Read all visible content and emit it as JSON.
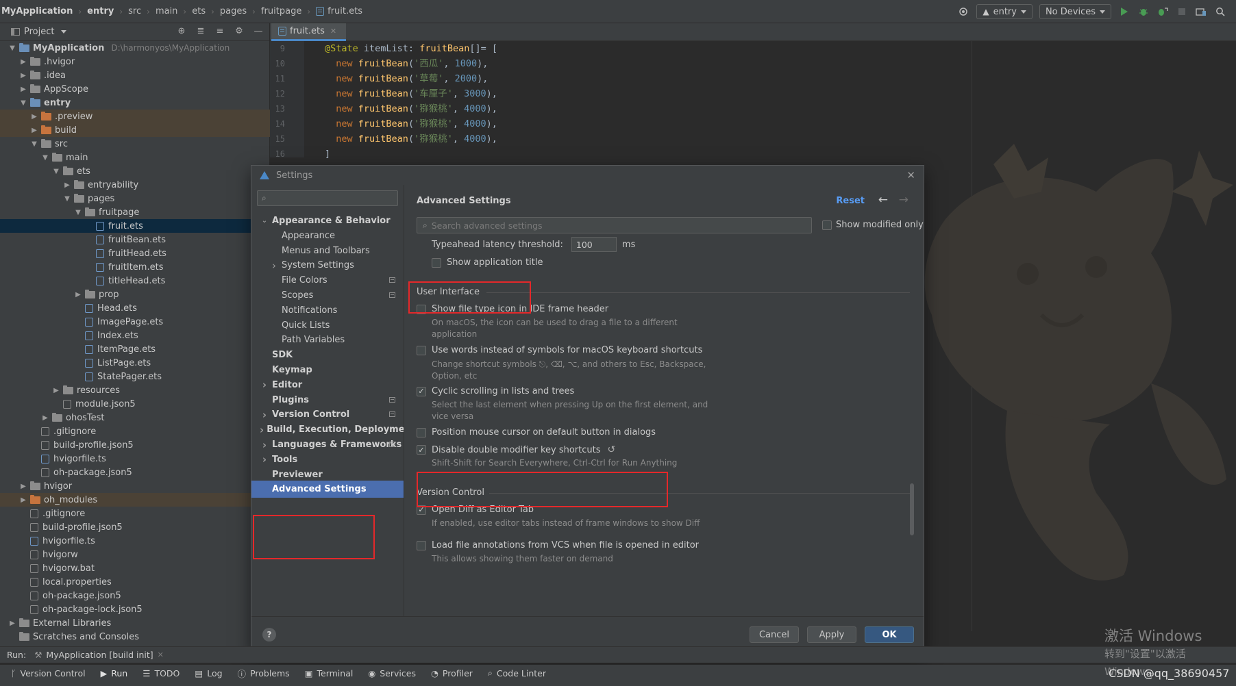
{
  "topbar": {
    "breadcrumbs": [
      "MyApplication",
      "entry",
      "src",
      "main",
      "ets",
      "pages",
      "fruitpage",
      "fruit.ets"
    ],
    "run_config": "entry",
    "device": "No Devices"
  },
  "project": {
    "panel_title": "Project",
    "tree": [
      {
        "label": "MyApplication",
        "path": "D:\\harmonyos\\MyApplication",
        "depth": 0,
        "expanded": true,
        "kind": "module"
      },
      {
        "label": ".hvigor",
        "depth": 1,
        "kind": "folder"
      },
      {
        "label": ".idea",
        "depth": 1,
        "kind": "folder"
      },
      {
        "label": "AppScope",
        "depth": 1,
        "kind": "folder"
      },
      {
        "label": "entry",
        "depth": 1,
        "expanded": true,
        "kind": "module"
      },
      {
        "label": ".preview",
        "depth": 2,
        "kind": "folder-orange",
        "hl": "brown"
      },
      {
        "label": "build",
        "depth": 2,
        "kind": "folder-orange",
        "hl": "brown"
      },
      {
        "label": "src",
        "depth": 2,
        "expanded": true,
        "kind": "folder"
      },
      {
        "label": "main",
        "depth": 3,
        "expanded": true,
        "kind": "folder"
      },
      {
        "label": "ets",
        "depth": 4,
        "expanded": true,
        "kind": "folder"
      },
      {
        "label": "entryability",
        "depth": 5,
        "kind": "folder"
      },
      {
        "label": "pages",
        "depth": 5,
        "expanded": true,
        "kind": "folder"
      },
      {
        "label": "fruitpage",
        "depth": 6,
        "expanded": true,
        "kind": "folder"
      },
      {
        "label": "fruit.ets",
        "depth": 7,
        "kind": "file",
        "hl": "sel"
      },
      {
        "label": "fruitBean.ets",
        "depth": 7,
        "kind": "file"
      },
      {
        "label": "fruitHead.ets",
        "depth": 7,
        "kind": "file"
      },
      {
        "label": "fruitItem.ets",
        "depth": 7,
        "kind": "file"
      },
      {
        "label": "titleHead.ets",
        "depth": 7,
        "kind": "file"
      },
      {
        "label": "prop",
        "depth": 6,
        "kind": "folder"
      },
      {
        "label": "Head.ets",
        "depth": 6,
        "kind": "file"
      },
      {
        "label": "ImagePage.ets",
        "depth": 6,
        "kind": "file"
      },
      {
        "label": "Index.ets",
        "depth": 6,
        "kind": "file"
      },
      {
        "label": "ItemPage.ets",
        "depth": 6,
        "kind": "file"
      },
      {
        "label": "ListPage.ets",
        "depth": 6,
        "kind": "file"
      },
      {
        "label": "StatePager.ets",
        "depth": 6,
        "kind": "file"
      },
      {
        "label": "resources",
        "depth": 4,
        "kind": "folder"
      },
      {
        "label": "module.json5",
        "depth": 4,
        "kind": "file-gray"
      },
      {
        "label": "ohosTest",
        "depth": 3,
        "kind": "folder"
      },
      {
        "label": ".gitignore",
        "depth": 2,
        "kind": "file-gray"
      },
      {
        "label": "build-profile.json5",
        "depth": 2,
        "kind": "file-gray"
      },
      {
        "label": "hvigorfile.ts",
        "depth": 2,
        "kind": "file"
      },
      {
        "label": "oh-package.json5",
        "depth": 2,
        "kind": "file-gray"
      },
      {
        "label": "hvigor",
        "depth": 1,
        "kind": "folder"
      },
      {
        "label": "oh_modules",
        "depth": 1,
        "kind": "folder-orange",
        "hl": "brown"
      },
      {
        "label": ".gitignore",
        "depth": 1,
        "kind": "file-gray"
      },
      {
        "label": "build-profile.json5",
        "depth": 1,
        "kind": "file-gray"
      },
      {
        "label": "hvigorfile.ts",
        "depth": 1,
        "kind": "file"
      },
      {
        "label": "hvigorw",
        "depth": 1,
        "kind": "file-gray"
      },
      {
        "label": "hvigorw.bat",
        "depth": 1,
        "kind": "file-gray"
      },
      {
        "label": "local.properties",
        "depth": 1,
        "kind": "file-gray"
      },
      {
        "label": "oh-package.json5",
        "depth": 1,
        "kind": "file-gray"
      },
      {
        "label": "oh-package-lock.json5",
        "depth": 1,
        "kind": "file-gray"
      },
      {
        "label": "External Libraries",
        "depth": 0,
        "kind": "libs"
      },
      {
        "label": "Scratches and Consoles",
        "depth": 0,
        "kind": "scratch"
      }
    ]
  },
  "editor": {
    "tab": "fruit.ets",
    "lines": [
      {
        "num": "9",
        "parts": [
          [
            "kw-ann",
            "@State "
          ],
          [
            "df",
            "itemList: "
          ],
          [
            "fn",
            "fruitBean"
          ],
          [
            "df",
            "[]= ["
          ]
        ]
      },
      {
        "num": "10",
        "parts": [
          [
            "kw",
            "  new "
          ],
          [
            "fn",
            "fruitBean"
          ],
          [
            "df",
            "("
          ],
          [
            "st",
            "'西瓜'"
          ],
          [
            "df",
            ", "
          ],
          [
            "nu",
            "1000"
          ],
          [
            "df",
            "),"
          ]
        ]
      },
      {
        "num": "11",
        "parts": [
          [
            "kw",
            "  new "
          ],
          [
            "fn",
            "fruitBean"
          ],
          [
            "df",
            "("
          ],
          [
            "st",
            "'草莓'"
          ],
          [
            "df",
            ", "
          ],
          [
            "nu",
            "2000"
          ],
          [
            "df",
            "),"
          ]
        ]
      },
      {
        "num": "12",
        "parts": [
          [
            "kw",
            "  new "
          ],
          [
            "fn",
            "fruitBean"
          ],
          [
            "df",
            "("
          ],
          [
            "st",
            "'车厘子'"
          ],
          [
            "df",
            ", "
          ],
          [
            "nu",
            "3000"
          ],
          [
            "df",
            "),"
          ]
        ]
      },
      {
        "num": "13",
        "parts": [
          [
            "kw",
            "  new "
          ],
          [
            "fn",
            "fruitBean"
          ],
          [
            "df",
            "("
          ],
          [
            "st",
            "'猕猴桃'"
          ],
          [
            "df",
            ", "
          ],
          [
            "nu",
            "4000"
          ],
          [
            "df",
            "),"
          ]
        ]
      },
      {
        "num": "14",
        "parts": [
          [
            "kw",
            "  new "
          ],
          [
            "fn",
            "fruitBean"
          ],
          [
            "df",
            "("
          ],
          [
            "st",
            "'猕猴桃'"
          ],
          [
            "df",
            ", "
          ],
          [
            "nu",
            "4000"
          ],
          [
            "df",
            "),"
          ]
        ]
      },
      {
        "num": "15",
        "parts": [
          [
            "kw",
            "  new "
          ],
          [
            "fn",
            "fruitBean"
          ],
          [
            "df",
            "("
          ],
          [
            "st",
            "'猕猴桃'"
          ],
          [
            "df",
            ", "
          ],
          [
            "nu",
            "4000"
          ],
          [
            "df",
            "),"
          ]
        ]
      },
      {
        "num": "16",
        "parts": [
          [
            "df",
            "]"
          ]
        ]
      }
    ]
  },
  "dialog": {
    "title": "Settings",
    "search_placeholder": "",
    "nav": [
      {
        "label": "Appearance & Behavior",
        "bold": true,
        "arrow": "down",
        "indent": 0
      },
      {
        "label": "Appearance",
        "indent": 1
      },
      {
        "label": "Menus and Toolbars",
        "indent": 1
      },
      {
        "label": "System Settings",
        "indent": 1,
        "arrow": "right"
      },
      {
        "label": "File Colors",
        "indent": 1,
        "badge": true
      },
      {
        "label": "Scopes",
        "indent": 1,
        "badge": true
      },
      {
        "label": "Notifications",
        "indent": 1
      },
      {
        "label": "Quick Lists",
        "indent": 1
      },
      {
        "label": "Path Variables",
        "indent": 1
      },
      {
        "label": "SDK",
        "bold": true,
        "indent": 0
      },
      {
        "label": "Keymap",
        "bold": true,
        "indent": 0
      },
      {
        "label": "Editor",
        "bold": true,
        "arrow": "right",
        "indent": 0
      },
      {
        "label": "Plugins",
        "bold": true,
        "indent": 0,
        "badge": true
      },
      {
        "label": "Version Control",
        "bold": true,
        "arrow": "right",
        "indent": 0,
        "badge": true
      },
      {
        "label": "Build, Execution, Deployment",
        "bold": true,
        "arrow": "right",
        "indent": 0
      },
      {
        "label": "Languages & Frameworks",
        "bold": true,
        "arrow": "right",
        "indent": 0,
        "badge": true
      },
      {
        "label": "Tools",
        "bold": true,
        "arrow": "right",
        "indent": 0
      },
      {
        "label": "Previewer",
        "bold": true,
        "indent": 0
      },
      {
        "label": "Advanced Settings",
        "bold": true,
        "indent": 0,
        "selected": true
      }
    ],
    "panel": {
      "title": "Advanced Settings",
      "reset": "Reset",
      "search_placeholder": "Search advanced settings",
      "show_modified_only": "Show modified only",
      "typeahead_label": "Typeahead latency threshold:",
      "typeahead_value": "100",
      "typeahead_unit": "ms",
      "show_app_title": "Show application title",
      "section_ui": "User Interface",
      "opt_file_type_icon": "Show file type icon in IDE frame header",
      "desc_file_type_icon": "On macOS, the icon can be used to drag a file to a different application",
      "opt_words_symbols": "Use words instead of symbols for macOS keyboard shortcuts",
      "desc_words_symbols": "Change shortcut symbols ⎋, ⌫, ⌥, and others to Esc, Backspace, Option, etc",
      "opt_cyclic": "Cyclic scrolling in lists and trees",
      "desc_cyclic": "Select the last element when pressing Up on the first element, and vice versa",
      "opt_mouse_cursor": "Position mouse cursor on default button in dialogs",
      "opt_double_modifier": "Disable double modifier key shortcuts",
      "desc_double_modifier": "Shift-Shift for Search Everywhere, Ctrl-Ctrl for Run Anything",
      "section_vc": "Version Control",
      "opt_open_diff": "Open Diff as Editor Tab",
      "desc_open_diff": "If enabled, use editor tabs instead of frame windows to show Diff",
      "opt_load_annotations": "Load file annotations from VCS when file is opened in editor",
      "desc_load_annotations": "This allows showing them faster on demand"
    },
    "buttons": {
      "cancel": "Cancel",
      "apply": "Apply",
      "ok": "OK",
      "help": "?"
    }
  },
  "runbar": {
    "label": "Run:",
    "config": "MyApplication [build init]"
  },
  "toolwindows": [
    "Version Control",
    "Run",
    "TODO",
    "Log",
    "Problems",
    "Terminal",
    "Services",
    "Profiler",
    "Code Linter"
  ],
  "watermark": {
    "line1": "激活 Windows",
    "line2": "转到\"设置\"以激活 Windows。"
  },
  "csdn": "CSDN @qq_38690457",
  "colors": {
    "accent": "#4b6eaf",
    "highlight": "#e5282a",
    "link": "#589df6"
  }
}
